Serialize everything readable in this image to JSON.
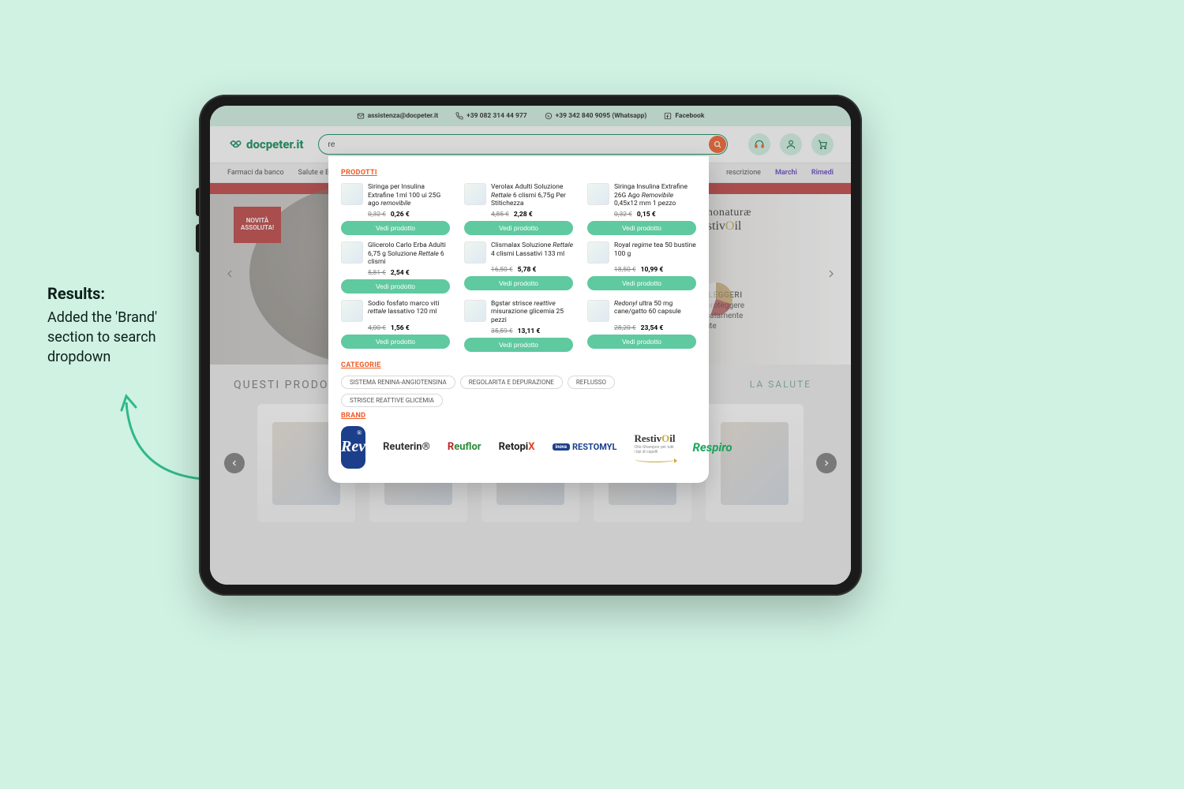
{
  "annotation": {
    "title": "Results:",
    "body": "Added the 'Brand' section to search dropdown"
  },
  "contact": {
    "email_label": "assistenza@docpeter.it",
    "phone1": "+39 082 314 44 977",
    "phone2": "+39 342 840 9095 (Whatsapp)",
    "facebook": "Facebook"
  },
  "header": {
    "logo": "docpeter.it",
    "search_value": "re"
  },
  "nav": {
    "items": [
      "Farmaci da banco",
      "Salute e Benessere"
    ],
    "right_items": [
      "rescrizione",
      "Marchi",
      "Rimedi"
    ]
  },
  "hero": {
    "badge1": "NOVITÀ",
    "badge2": "ASSOLUTA!",
    "brand_top": "tecnonaturæ",
    "brand_bottom_a": "Restiv",
    "brand_bottom_b": "il",
    "oli_title": "OLI LEGGERI",
    "oli_l1": "per proteggere",
    "oli_l2": "delicatamente",
    "oli_l3": "la cute",
    "section1": "QUESTI PRODOTTI",
    "section2": "LA SALUTE"
  },
  "dropdown": {
    "products_heading": "PRODOTTI",
    "categories_heading": "CATEGORIE",
    "brand_heading": "BRAND",
    "view_label": "Vedi prodotto",
    "products": [
      {
        "name": "Siringa per Insulina Extrafine 1ml 100 ui 25G ago removibile",
        "old": "0,32 €",
        "new": "0,26 €"
      },
      {
        "name": "Verolax Adulti Soluzione Rettale 6 clismi 6,75g Per Stitichezza",
        "old": "4,85 €",
        "new": "2,28 €"
      },
      {
        "name": "Siringa Insulina Extrafine 26G Ago Removibile 0,45x12 mm 1 pezzo",
        "old": "0,32 €",
        "new": "0,15 €"
      },
      {
        "name": "Glicerolo Carlo Erba Adulti 6,75 g Soluzione Rettale 6 clismi",
        "old": "5,81 €",
        "new": "2,54 €"
      },
      {
        "name": "Clismalax Soluzione Rettale 4 clismi Lassativi 133 ml",
        "old": "16,50 €",
        "new": "5,78 €"
      },
      {
        "name": "Royal regime tea 50 bustine 100 g",
        "old": "18,50 €",
        "new": "10,99 €"
      },
      {
        "name": "Sodio fosfato marco viti rettale lassativo 120 ml",
        "old": "4,00 €",
        "new": "1,56 €"
      },
      {
        "name": "Bgstar strisce reattive misurazione glicemia 25 pezzi",
        "old": "35,59 €",
        "new": "13,11 €"
      },
      {
        "name": "Redonyl ultra 50 mg cane/gatto 60 capsule",
        "old": "28,20 €",
        "new": "23,54 €"
      }
    ],
    "categories": [
      "SISTEMA RENINA-ANGIOTENSINA",
      "REGOLARITA E DEPURAZIONE",
      "REFLUSSO",
      "STRISCE REATTIVE GLICEMIA"
    ],
    "brands": {
      "rev": "Rev",
      "reuterin": "Reuterin®",
      "reuflor_r": "R",
      "reuflor_rest": "euflor",
      "retopix_a": "Retopi",
      "retopix_b": "X",
      "restomyl_pill": "inova",
      "restomyl": "RESTOMYL",
      "restivoil_a": "Restiv",
      "restivoil_b": "il",
      "restivoil_sub": "Olio-Shampoo per tutti i tipi di capelli",
      "respiro": "Respiro"
    }
  }
}
